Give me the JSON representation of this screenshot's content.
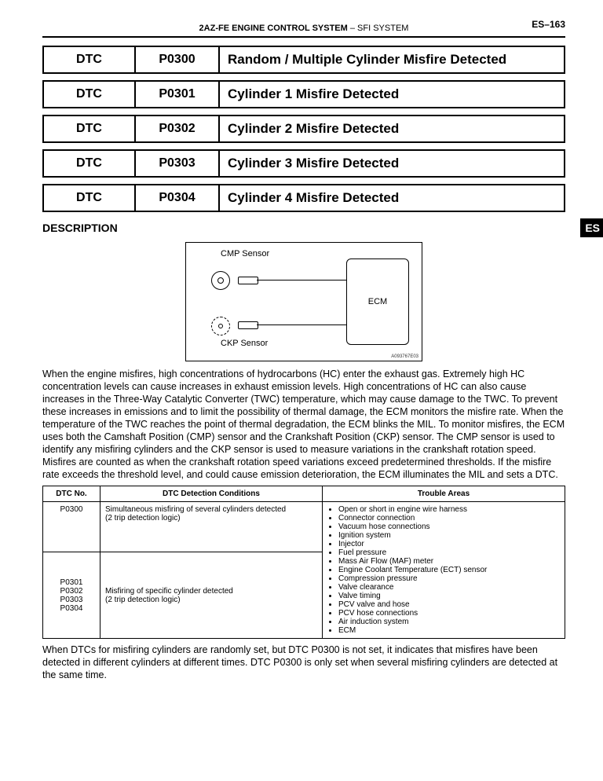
{
  "header": {
    "left_title": "2AZ-FE ENGINE CONTROL SYSTEM",
    "dash": "  –  ",
    "right_title": "SFI SYSTEM",
    "page_code": "ES–163"
  },
  "dtc_rows": [
    {
      "c1": "DTC",
      "c2": "P0300",
      "c3": "Random / Multiple Cylinder Misfire Detected"
    },
    {
      "c1": "DTC",
      "c2": "P0301",
      "c3": "Cylinder 1 Misfire Detected"
    },
    {
      "c1": "DTC",
      "c2": "P0302",
      "c3": "Cylinder 2 Misfire Detected"
    },
    {
      "c1": "DTC",
      "c2": "P0303",
      "c3": "Cylinder 3 Misfire Detected"
    },
    {
      "c1": "DTC",
      "c2": "P0304",
      "c3": "Cylinder 4 Misfire Detected"
    }
  ],
  "description_heading": "DESCRIPTION",
  "side_tab": "ES",
  "diagram": {
    "cmp": "CMP Sensor",
    "ckp": "CKP Sensor",
    "ecm": "ECM",
    "figno": "A093767E03"
  },
  "para1": "When the engine misfires, high concentrations of hydrocarbons (HC) enter the exhaust gas. Extremely high HC concentration levels can cause increases in exhaust emission levels. High concentrations of HC can also cause increases in the Three-Way Catalytic Converter (TWC) temperature, which may cause damage to the TWC. To prevent these increases in emissions and to limit the possibility of thermal damage, the ECM monitors the misfire rate. When the temperature of the TWC reaches the point of thermal degradation, the ECM blinks the MIL. To monitor misfires, the ECM uses both the Camshaft Position (CMP) sensor and the Crankshaft Position (CKP) sensor. The CMP sensor is used to identify any misfiring cylinders and the CKP sensor is used to measure variations in the crankshaft rotation speed. Misfires are counted as when the crankshaft rotation speed variations exceed predetermined thresholds. If the misfire rate exceeds the threshold level, and could cause emission deterioration, the ECM illuminates the MIL and sets a DTC.",
  "cond_table": {
    "headers": {
      "dtc": "DTC No.",
      "cond": "DTC Detection Conditions",
      "trouble": "Trouble Areas"
    },
    "rows": [
      {
        "dtc": "P0300",
        "cond": "Simultaneous misfiring of several cylinders detected\n(2 trip detection logic)"
      },
      {
        "dtc": "P0301\nP0302\nP0303\nP0304",
        "cond": "Misfiring of specific cylinder detected\n(2 trip detection logic)"
      }
    ],
    "trouble_items": [
      "Open or short in engine wire harness",
      "Connector connection",
      "Vacuum hose connections",
      "Ignition system",
      "Injector",
      "Fuel pressure",
      "Mass Air Flow (MAF) meter",
      "Engine Coolant Temperature (ECT) sensor",
      "Compression pressure",
      "Valve clearance",
      "Valve timing",
      "PCV valve and hose",
      "PCV hose connections",
      "Air induction system",
      "ECM"
    ]
  },
  "para2": "When DTCs for misfiring cylinders are randomly set, but DTC P0300 is not set, it indicates that misfires have been detected in different cylinders at different times. DTC P0300 is only set when several misfiring cylinders are detected at the same time."
}
